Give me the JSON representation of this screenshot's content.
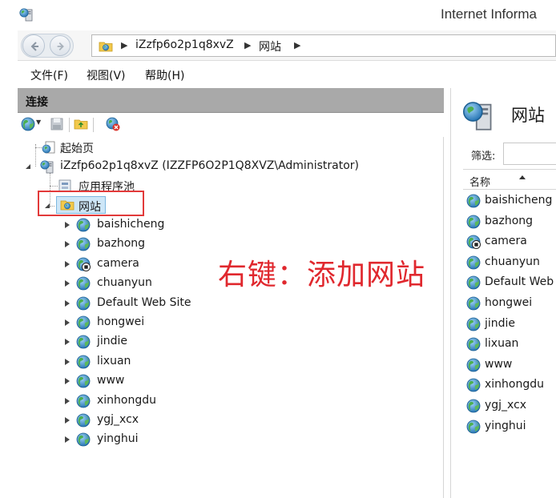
{
  "window": {
    "title": "Internet Informa"
  },
  "address": {
    "crumbs": [
      "iZzfp6o2p1q8xvZ",
      "网站"
    ]
  },
  "menu": {
    "file": "文件(F)",
    "view": "视图(V)",
    "help": "帮助(H)"
  },
  "connections": {
    "header": "连接",
    "tree": {
      "start_page": "起始页",
      "server": "iZzfp6o2p1q8xvZ (IZZFP6O2P1Q8XVZ\\Administrator)",
      "app_pools": "应用程序池",
      "sites_node": "网站",
      "sites": [
        {
          "name": "baishicheng",
          "icon": "globe-icon"
        },
        {
          "name": "bazhong",
          "icon": "globe-icon"
        },
        {
          "name": "camera",
          "icon": "stopped-site-icon"
        },
        {
          "name": "chuanyun",
          "icon": "globe-icon"
        },
        {
          "name": "Default Web Site",
          "icon": "globe-icon"
        },
        {
          "name": "hongwei",
          "icon": "globe-icon"
        },
        {
          "name": "jindie",
          "icon": "globe-icon"
        },
        {
          "name": "lixuan",
          "icon": "globe-icon"
        },
        {
          "name": "www",
          "icon": "globe-icon"
        },
        {
          "name": "xinhongdu",
          "icon": "globe-icon"
        },
        {
          "name": "ygj_xcx",
          "icon": "globe-icon"
        },
        {
          "name": "yinghui",
          "icon": "globe-icon"
        }
      ]
    }
  },
  "annotation": {
    "text": "右键：添加网站",
    "color": "#e0282e"
  },
  "right_pane": {
    "title": "网站",
    "filter_label": "筛选:",
    "column_name": "名称",
    "items": [
      {
        "name": "baishicheng",
        "icon": "globe-icon"
      },
      {
        "name": "bazhong",
        "icon": "globe-icon"
      },
      {
        "name": "camera",
        "icon": "stopped-site-icon"
      },
      {
        "name": "chuanyun",
        "icon": "globe-icon"
      },
      {
        "name": "Default Web",
        "icon": "globe-icon"
      },
      {
        "name": "hongwei",
        "icon": "globe-icon"
      },
      {
        "name": "jindie",
        "icon": "globe-icon"
      },
      {
        "name": "lixuan",
        "icon": "globe-icon"
      },
      {
        "name": "www",
        "icon": "globe-icon"
      },
      {
        "name": "xinhongdu",
        "icon": "globe-icon"
      },
      {
        "name": "ygj_xcx",
        "icon": "globe-icon"
      },
      {
        "name": "yinghui",
        "icon": "globe-icon"
      }
    ]
  },
  "colors": {
    "accent_red": "#e23a3a",
    "header_gray": "#a9a9a9",
    "selection_blue": "#cde6f7"
  }
}
